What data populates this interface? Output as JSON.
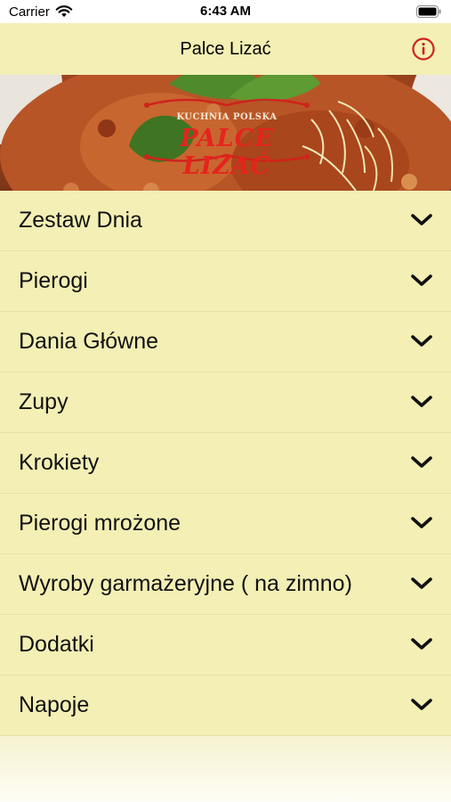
{
  "status_bar": {
    "carrier": "Carrier",
    "time": "6:43 AM"
  },
  "nav": {
    "title": "Palce Lizać"
  },
  "banner": {
    "logo_subtitle": "KUCHNIA POLSKA",
    "logo_title": "PALCE LIZAĆ"
  },
  "menu": {
    "items": [
      {
        "label": "Zestaw Dnia"
      },
      {
        "label": "Pierogi"
      },
      {
        "label": "Dania Główne"
      },
      {
        "label": "Zupy"
      },
      {
        "label": "Krokiety"
      },
      {
        "label": "Pierogi mrożone"
      },
      {
        "label": "Wyroby garmażeryjne ( na zimno)"
      },
      {
        "label": "Dodatki"
      },
      {
        "label": "Napoje"
      }
    ]
  },
  "colors": {
    "background": "#f3efb5",
    "accent": "#d0231c"
  },
  "icons": [
    "wifi-icon",
    "battery-icon",
    "info-icon",
    "chevron-down-icon"
  ]
}
